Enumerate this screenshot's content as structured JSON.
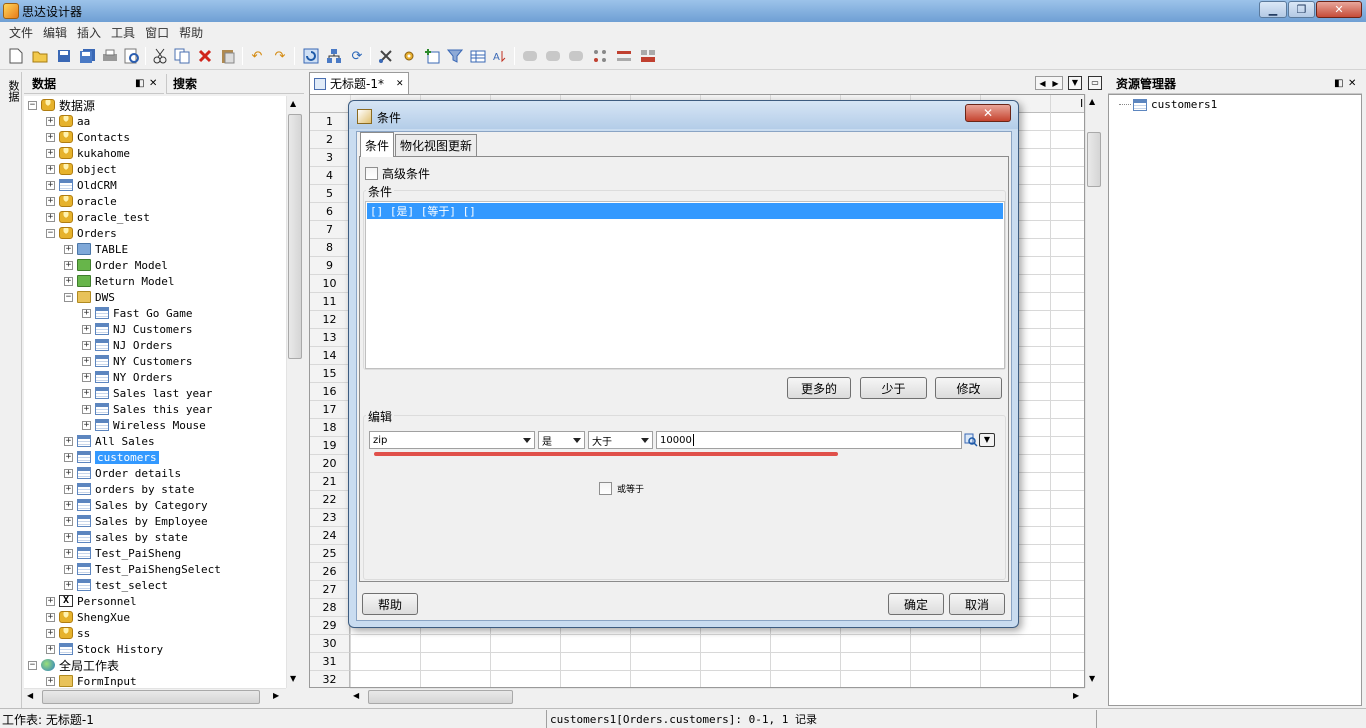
{
  "window": {
    "title": "思达设计器",
    "minimize": "▁",
    "restore": "❐",
    "close": "✕"
  },
  "menu": [
    "文件",
    "编辑",
    "插入",
    "工具",
    "窗口",
    "帮助"
  ],
  "side_strip": {
    "label": "数据"
  },
  "left_panel": {
    "tab_data": "数据",
    "tab_search": "搜索",
    "tree": [
      {
        "label": "数据源",
        "icon": "database-icon",
        "level": 0,
        "expanded": true
      },
      {
        "label": "aa",
        "icon": "database-icon",
        "level": 1
      },
      {
        "label": "Contacts",
        "icon": "contacts-icon",
        "level": 1
      },
      {
        "label": "kukahome",
        "icon": "database-icon",
        "level": 1
      },
      {
        "label": "object",
        "icon": "object-icon",
        "level": 1
      },
      {
        "label": "OldCRM",
        "icon": "crm-icon",
        "level": 1
      },
      {
        "label": "oracle",
        "icon": "database-icon",
        "level": 1
      },
      {
        "label": "oracle_test",
        "icon": "database-icon",
        "level": 1
      },
      {
        "label": "Orders",
        "icon": "database-icon",
        "level": 1,
        "expanded": true
      },
      {
        "label": "TABLE",
        "icon": "folder-blue-icon",
        "level": 2
      },
      {
        "label": "Order Model",
        "icon": "folder-green-icon",
        "level": 2
      },
      {
        "label": "Return Model",
        "icon": "folder-green-icon",
        "level": 2
      },
      {
        "label": "DWS",
        "icon": "folder-icon",
        "level": 2,
        "expanded": true
      },
      {
        "label": "Fast Go Game",
        "icon": "table-icon",
        "level": 3
      },
      {
        "label": "NJ Customers",
        "icon": "table-icon",
        "level": 3
      },
      {
        "label": "NJ Orders",
        "icon": "table-icon",
        "level": 3
      },
      {
        "label": "NY Customers",
        "icon": "table-icon",
        "level": 3
      },
      {
        "label": "NY Orders",
        "icon": "table-icon",
        "level": 3
      },
      {
        "label": "Sales last year",
        "icon": "table-icon",
        "level": 3
      },
      {
        "label": "Sales this year",
        "icon": "table-icon",
        "level": 3
      },
      {
        "label": "Wireless Mouse",
        "icon": "table-icon",
        "level": 3
      },
      {
        "label": "All Sales",
        "icon": "table-icon",
        "level": 2
      },
      {
        "label": "customers",
        "icon": "table-icon",
        "level": 2,
        "selected": true
      },
      {
        "label": "Order details",
        "icon": "table-icon",
        "level": 2
      },
      {
        "label": "orders by state",
        "icon": "table-icon",
        "level": 2
      },
      {
        "label": "Sales by Category",
        "icon": "table-icon",
        "level": 2
      },
      {
        "label": "Sales by Employee",
        "icon": "table-icon",
        "level": 2
      },
      {
        "label": "sales by state",
        "icon": "table-icon",
        "level": 2
      },
      {
        "label": "Test_PaiSheng",
        "icon": "table-icon",
        "level": 2
      },
      {
        "label": "Test_PaiShengSelect",
        "icon": "table-icon",
        "level": 2
      },
      {
        "label": "test_select",
        "icon": "table-icon",
        "level": 2
      },
      {
        "label": "Personnel",
        "icon": "excel-icon",
        "level": 1
      },
      {
        "label": "ShengXue",
        "icon": "database-icon",
        "level": 1
      },
      {
        "label": "ss",
        "icon": "database-icon",
        "level": 1
      },
      {
        "label": "Stock History",
        "icon": "stock-icon",
        "level": 1
      },
      {
        "label": "全局工作表",
        "icon": "globe-icon",
        "level": 0,
        "expanded": true
      },
      {
        "label": "FormInput",
        "icon": "folder-icon",
        "level": 1
      }
    ]
  },
  "doc_tab": {
    "title": "无标题-1*"
  },
  "grid": {
    "rows": [
      "1",
      "2",
      "3",
      "4",
      "5",
      "6",
      "7",
      "8",
      "9",
      "10",
      "11",
      "12",
      "13",
      "14",
      "15",
      "16",
      "17",
      "18",
      "19",
      "20",
      "21",
      "22",
      "23",
      "24",
      "25",
      "26",
      "27",
      "28",
      "29",
      "30",
      "31",
      "32"
    ],
    "last_col": "I"
  },
  "right_panel": {
    "title": "资源管理器",
    "items": [
      "customers1"
    ]
  },
  "dialog": {
    "title": "条件",
    "close": "✕",
    "tabs": [
      "条件",
      "物化视图更新"
    ],
    "advanced_label": "高级条件",
    "conditions_label": "条件",
    "conditions": [
      "[] [是] [等于] []"
    ],
    "btn_more": "更多的",
    "btn_less": "少于",
    "btn_modify": "修改",
    "edit_label": "编辑",
    "field_combo": "zip",
    "is_combo": "是",
    "op_combo": "大于",
    "value_input": "10000",
    "or_equal_label": "或等于",
    "btn_help": "帮助",
    "btn_ok": "确定",
    "btn_cancel": "取消"
  },
  "status": {
    "left": "工作表: 无标题-1",
    "middle": "customers1[Orders.customers]: 0-1, 1 记录"
  }
}
